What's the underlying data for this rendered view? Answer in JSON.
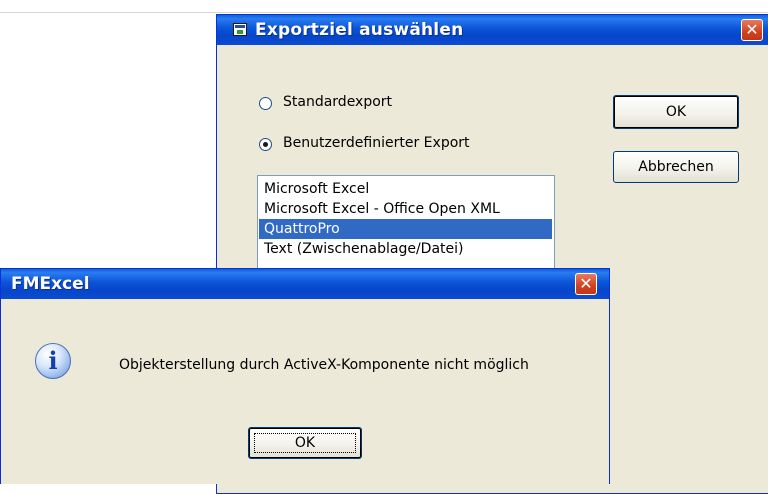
{
  "export_dialog": {
    "title": "Exportziel auswählen",
    "close_glyph": "✕",
    "radios": [
      {
        "label": "Standardexport",
        "checked": false
      },
      {
        "label": "Benutzerdefinierter Export",
        "checked": true
      }
    ],
    "targets": [
      {
        "label": "Microsoft Excel",
        "selected": false
      },
      {
        "label": "Microsoft Excel - Office Open XML",
        "selected": false
      },
      {
        "label": "QuattroPro",
        "selected": true
      },
      {
        "label": "Text (Zwischenablage/Datei)",
        "selected": false
      }
    ],
    "ok_label": "OK",
    "cancel_label": "Abbrechen"
  },
  "message_dialog": {
    "title": "FMExcel",
    "close_glyph": "✕",
    "icon": "info-icon",
    "icon_glyph": "i",
    "message": "Objekterstellung durch ActiveX-Komponente nicht möglich",
    "ok_label": "OK"
  },
  "colors": {
    "titlebar": "#0a54d8",
    "dialog_face": "#ece9d8",
    "selection": "#316ac5",
    "close_button": "#d0421f"
  }
}
